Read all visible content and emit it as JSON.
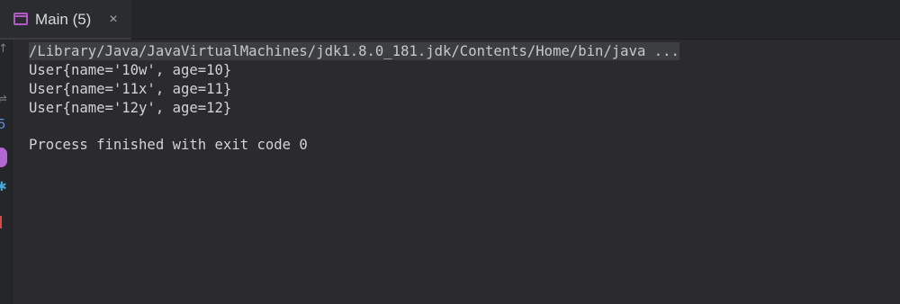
{
  "tab": {
    "icon": "console-window-icon",
    "title": "Main (5)",
    "close_label": "×"
  },
  "gutter": {
    "icons": [
      "rerun-arrow-icon",
      "soft-wrap-icon",
      "five-icon",
      "stop-icon",
      "debug-icon",
      "trash-icon"
    ],
    "arrow_glyph": "↑",
    "wrap_glyph": "⇌",
    "five_glyph": "5",
    "debug_glyph": "✱"
  },
  "console": {
    "command": "/Library/Java/JavaVirtualMachines/jdk1.8.0_181.jdk/Contents/Home/bin/java ...",
    "output": [
      "User{name='10w', age=10}",
      "User{name='11x', age=11}",
      "User{name='12y', age=12}"
    ],
    "exit_message": "Process finished with exit code 0"
  },
  "colors": {
    "background": "#2b2b2d",
    "accent": "#b05ac8",
    "text": "#d1d3d6"
  }
}
